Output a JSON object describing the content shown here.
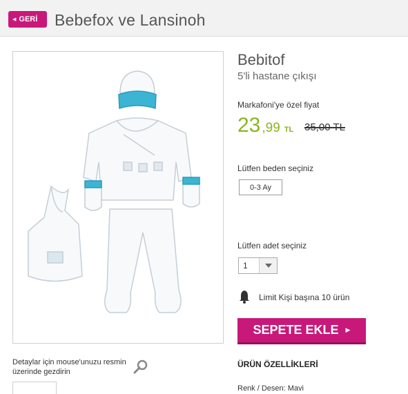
{
  "header": {
    "back_label": "GERİ",
    "title": "Bebefox ve Lansinoh",
    "back_icon": "caret-left-icon"
  },
  "product": {
    "brand": "Bebitof",
    "subtitle": "5'li hastane çıkışı",
    "special_price_label": "Markafoni'ye özel fiyat",
    "price_int": "23",
    "price_dec": ",99",
    "currency": "TL",
    "old_price": "35,00 TL",
    "price_color": "#8ab51e"
  },
  "gallery": {
    "hint": "Detaylar için mouse'unuzu resmin üzerinde gezdirin",
    "zoom_icon": "magnifier-icon"
  },
  "size": {
    "label": "Lütfen beden seçiniz",
    "options": [
      "0-3 Ay"
    ]
  },
  "quantity": {
    "label": "Lütfen adet seçiniz",
    "value": "1"
  },
  "limit": {
    "icon": "bell-icon",
    "text": "Limit Kişi başına 10 ürün"
  },
  "cart": {
    "label": "SEPETE EKLE",
    "accent": "#c8187a"
  },
  "features": {
    "title": "ÜRÜN ÖZELLİKLERİ",
    "color_line": "Renk / Desen: Mavi"
  }
}
